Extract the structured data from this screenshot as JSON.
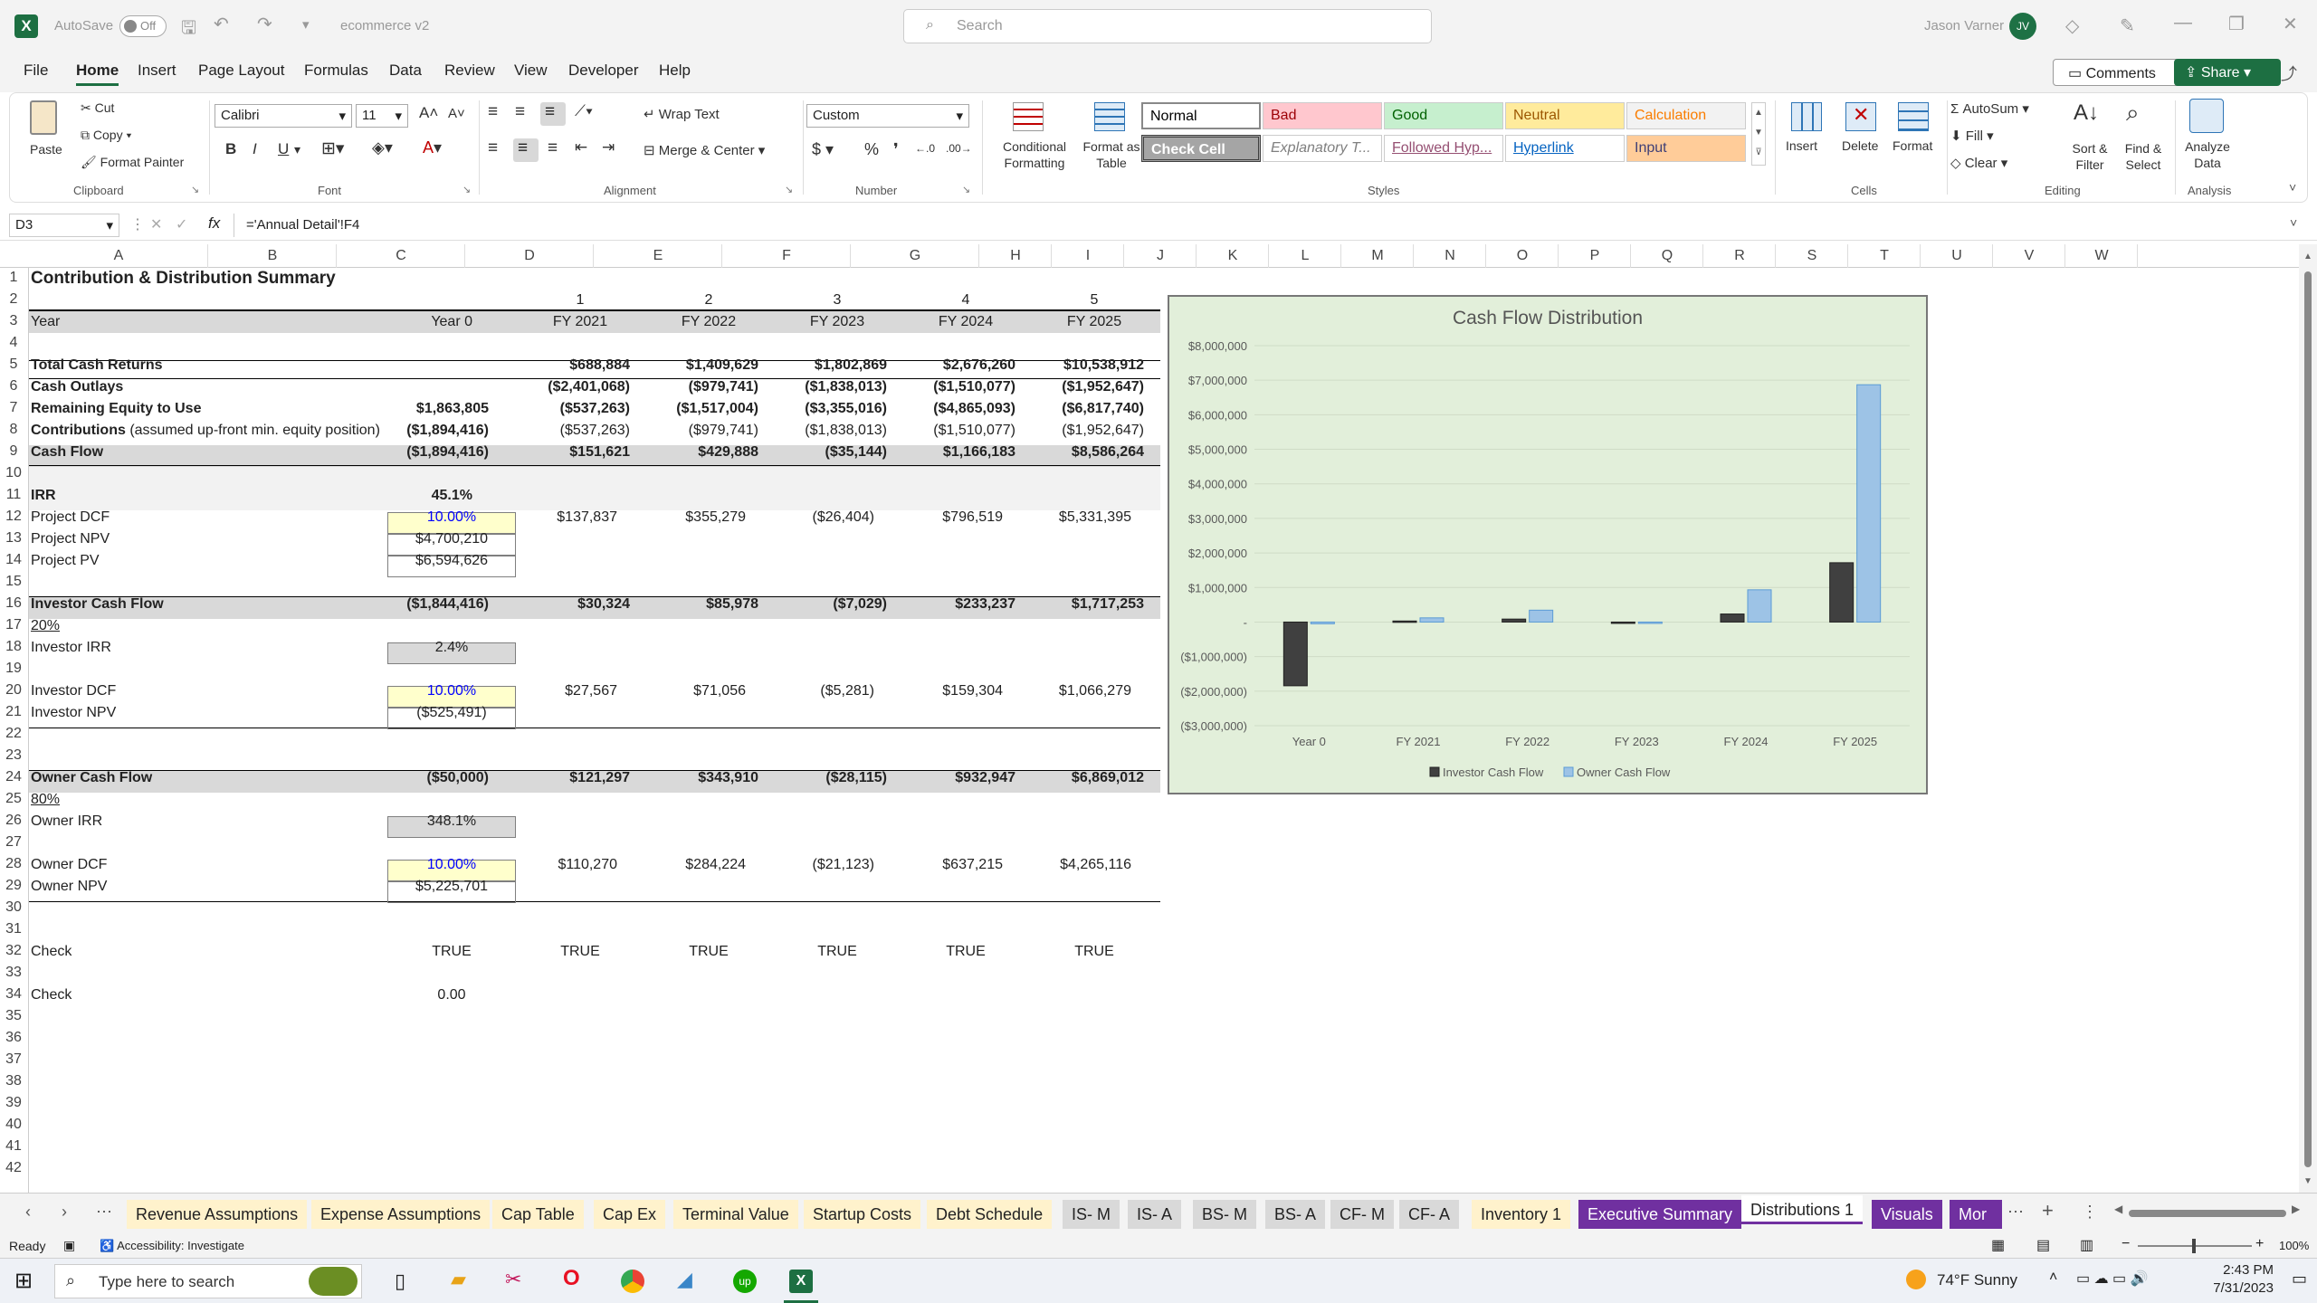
{
  "titlebar": {
    "autosave_label": "AutoSave",
    "autosave_state": "Off",
    "filename": "ecommerce v2",
    "search_placeholder": "Search",
    "user_name": "Jason Varner",
    "user_initials": "JV"
  },
  "menu": [
    "File",
    "Home",
    "Insert",
    "Page Layout",
    "Formulas",
    "Data",
    "Review",
    "View",
    "Developer",
    "Help"
  ],
  "menu_active": "Home",
  "menu_right": {
    "comments": "Comments",
    "share": "Share"
  },
  "ribbon": {
    "clipboard": {
      "paste": "Paste",
      "cut": "Cut",
      "copy": "Copy",
      "format_painter": "Format Painter",
      "label": "Clipboard"
    },
    "font": {
      "name": "Calibri",
      "size": "11",
      "label": "Font"
    },
    "alignment": {
      "wrap": "Wrap Text",
      "merge": "Merge & Center",
      "label": "Alignment"
    },
    "number": {
      "format": "Custom",
      "label": "Number"
    },
    "styles": {
      "conditional": "Conditional Formatting",
      "format_table": "Format as Table",
      "items": [
        {
          "label": "Normal",
          "bg": "#ffffff",
          "fg": "#000000"
        },
        {
          "label": "Bad",
          "bg": "#ffc7ce",
          "fg": "#9c0006"
        },
        {
          "label": "Good",
          "bg": "#c6efce",
          "fg": "#006100"
        },
        {
          "label": "Neutral",
          "bg": "#ffeb9c",
          "fg": "#9c5700"
        },
        {
          "label": "Calculation",
          "bg": "#f2f2f2",
          "fg": "#fa7d00"
        },
        {
          "label": "Check Cell",
          "bg": "#a5a5a5",
          "fg": "#ffffff"
        },
        {
          "label": "Explanatory T...",
          "bg": "#ffffff",
          "fg": "#7f7f7f"
        },
        {
          "label": "Followed Hyp...",
          "bg": "#ffffff",
          "fg": "#954f72"
        },
        {
          "label": "Hyperlink",
          "bg": "#ffffff",
          "fg": "#0563c1"
        },
        {
          "label": "Input",
          "bg": "#ffcc99",
          "fg": "#3f3f76"
        }
      ],
      "label": "Styles"
    },
    "cells": {
      "insert": "Insert",
      "delete": "Delete",
      "format": "Format",
      "label": "Cells"
    },
    "editing": {
      "autosum": "AutoSum",
      "fill": "Fill",
      "clear": "Clear",
      "sort": "Sort & Filter",
      "find": "Find & Select",
      "label": "Editing"
    },
    "analysis": {
      "analyze": "Analyze Data",
      "label": "Analysis"
    }
  },
  "formula_bar": {
    "name_box": "D3",
    "formula": "='Annual Detail'!F4"
  },
  "columns": [
    "A",
    "B",
    "C",
    "D",
    "E",
    "F",
    "G",
    "H",
    "I",
    "J",
    "K",
    "L",
    "M",
    "N",
    "O",
    "P",
    "Q",
    "R",
    "S",
    "T",
    "U",
    "V",
    "W"
  ],
  "sheet": {
    "title": "Contribution & Distribution Summary",
    "period_nums": [
      "1",
      "2",
      "3",
      "4",
      "5"
    ],
    "year_label": "Year",
    "years": [
      "Year 0",
      "FY 2021",
      "FY 2022",
      "FY 2023",
      "FY 2024",
      "FY 2025"
    ],
    "rows": {
      "total_cash_returns": {
        "label": "Total Cash Returns",
        "vals": [
          "",
          "$688,884",
          "$1,409,629",
          "$1,802,869",
          "$2,676,260",
          "$10,538,912"
        ]
      },
      "cash_outlays": {
        "label": "Cash Outlays",
        "vals": [
          "",
          "($2,401,068)",
          "($979,741)",
          "($1,838,013)",
          "($1,510,077)",
          "($1,952,647)"
        ]
      },
      "remaining_equity": {
        "label": "Remaining Equity to Use",
        "vals": [
          "$1,863,805",
          "($537,263)",
          "($1,517,004)",
          "($3,355,016)",
          "($4,865,093)",
          "($6,817,740)"
        ]
      },
      "contributions": {
        "label_bold": "Contributions",
        "label_rest": " (assumed up-front min. equity position)",
        "vals": [
          "($1,894,416)",
          "($537,263)",
          "($979,741)",
          "($1,838,013)",
          "($1,510,077)",
          "($1,952,647)"
        ]
      },
      "cash_flow": {
        "label": "Cash Flow",
        "vals": [
          "($1,894,416)",
          "$151,621",
          "$429,888",
          "($35,144)",
          "$1,166,183",
          "$8,586,264"
        ]
      },
      "irr": {
        "label": "IRR",
        "val": "45.1%"
      },
      "project_dcf": {
        "label": "Project DCF",
        "vals": [
          "10.00%",
          "$137,837",
          "$355,279",
          "($26,404)",
          "$796,519",
          "$5,331,395"
        ]
      },
      "project_npv": {
        "label": "Project NPV",
        "val": "$4,700,210"
      },
      "project_pv": {
        "label": "Project PV",
        "val": "$6,594,626"
      },
      "investor_cf": {
        "label": "Investor Cash Flow",
        "vals": [
          "($1,844,416)",
          "$30,324",
          "$85,978",
          "($7,029)",
          "$233,237",
          "$1,717,253"
        ]
      },
      "investor_pct": "20%",
      "investor_irr": {
        "label": "Investor IRR",
        "val": "2.4%"
      },
      "investor_dcf": {
        "label": "Investor DCF",
        "vals": [
          "10.00%",
          "$27,567",
          "$71,056",
          "($5,281)",
          "$159,304",
          "$1,066,279"
        ]
      },
      "investor_npv": {
        "label": "Investor NPV",
        "val": "($525,491)"
      },
      "owner_cf": {
        "label": "Owner Cash Flow",
        "vals": [
          "($50,000)",
          "$121,297",
          "$343,910",
          "($28,115)",
          "$932,947",
          "$6,869,012"
        ]
      },
      "owner_pct": "80%",
      "owner_irr": {
        "label": "Owner IRR",
        "val": "348.1%"
      },
      "owner_dcf": {
        "label": "Owner DCF",
        "vals": [
          "10.00%",
          "$110,270",
          "$284,224",
          "($21,123)",
          "$637,215",
          "$4,265,116"
        ]
      },
      "owner_npv": {
        "label": "Owner NPV",
        "val": "$5,225,701"
      },
      "check1": {
        "label": "Check",
        "vals": [
          "TRUE",
          "TRUE",
          "TRUE",
          "TRUE",
          "TRUE",
          "TRUE"
        ]
      },
      "check2": {
        "label": "Check",
        "val": "0.00"
      }
    }
  },
  "chart_data": {
    "type": "bar",
    "title": "Cash Flow Distribution",
    "categories": [
      "Year 0",
      "FY 2021",
      "FY 2022",
      "FY 2023",
      "FY 2024",
      "FY 2025"
    ],
    "series": [
      {
        "name": "Investor Cash Flow",
        "color": "#404040",
        "values": [
          -1844416,
          30324,
          85978,
          -7029,
          233237,
          1717253
        ]
      },
      {
        "name": "Owner Cash Flow",
        "color": "#9dc3e6",
        "values": [
          -50000,
          121297,
          343910,
          -28115,
          932947,
          6869012
        ]
      }
    ],
    "ylim": [
      -3000000,
      8000000
    ],
    "yticks": [
      "$8,000,000",
      "$7,000,000",
      "$6,000,000",
      "$5,000,000",
      "$4,000,000",
      "$3,000,000",
      "$2,000,000",
      "$1,000,000",
      "-",
      "($1,000,000)",
      "($2,000,000)",
      "($3,000,000)"
    ],
    "background": "#e2efda",
    "legend": "bottom"
  },
  "tabs": [
    {
      "label": "Revenue Assumptions",
      "bg": "#fff2cc",
      "fg": "#222"
    },
    {
      "label": "Expense Assumptions",
      "bg": "#fff2cc",
      "fg": "#222"
    },
    {
      "label": "Cap Table",
      "bg": "#fff2cc",
      "fg": "#222"
    },
    {
      "label": "Cap Ex",
      "bg": "#fff2cc",
      "fg": "#222"
    },
    {
      "label": "Terminal Value",
      "bg": "#fff2cc",
      "fg": "#222"
    },
    {
      "label": "Startup Costs",
      "bg": "#fff2cc",
      "fg": "#222"
    },
    {
      "label": "Debt Schedule",
      "bg": "#fff2cc",
      "fg": "#222"
    },
    {
      "label": "IS- M",
      "bg": "#d9d9d9",
      "fg": "#222"
    },
    {
      "label": "IS- A",
      "bg": "#d9d9d9",
      "fg": "#222"
    },
    {
      "label": "BS- M",
      "bg": "#d9d9d9",
      "fg": "#222"
    },
    {
      "label": "BS- A",
      "bg": "#d9d9d9",
      "fg": "#222"
    },
    {
      "label": "CF- M",
      "bg": "#d9d9d9",
      "fg": "#222"
    },
    {
      "label": "CF- A",
      "bg": "#d9d9d9",
      "fg": "#222"
    },
    {
      "label": "Inventory 1",
      "bg": "#fff2cc",
      "fg": "#222"
    },
    {
      "label": "Executive Summary",
      "bg": "#7030a0",
      "fg": "#fff"
    },
    {
      "label": "Distributions 1",
      "bg": "#f3f3f3",
      "fg": "#222"
    },
    {
      "label": "Visuals",
      "bg": "#7030a0",
      "fg": "#fff"
    },
    {
      "label": "Mor",
      "bg": "#7030a0",
      "fg": "#fff"
    }
  ],
  "active_tab": "Distributions 1",
  "status": {
    "ready": "Ready",
    "accessibility": "Accessibility: Investigate",
    "zoom": "100%"
  },
  "taskbar": {
    "search_placeholder": "Type here to search",
    "weather": "74°F  Sunny",
    "time": "2:43 PM",
    "date": "7/31/2023"
  }
}
